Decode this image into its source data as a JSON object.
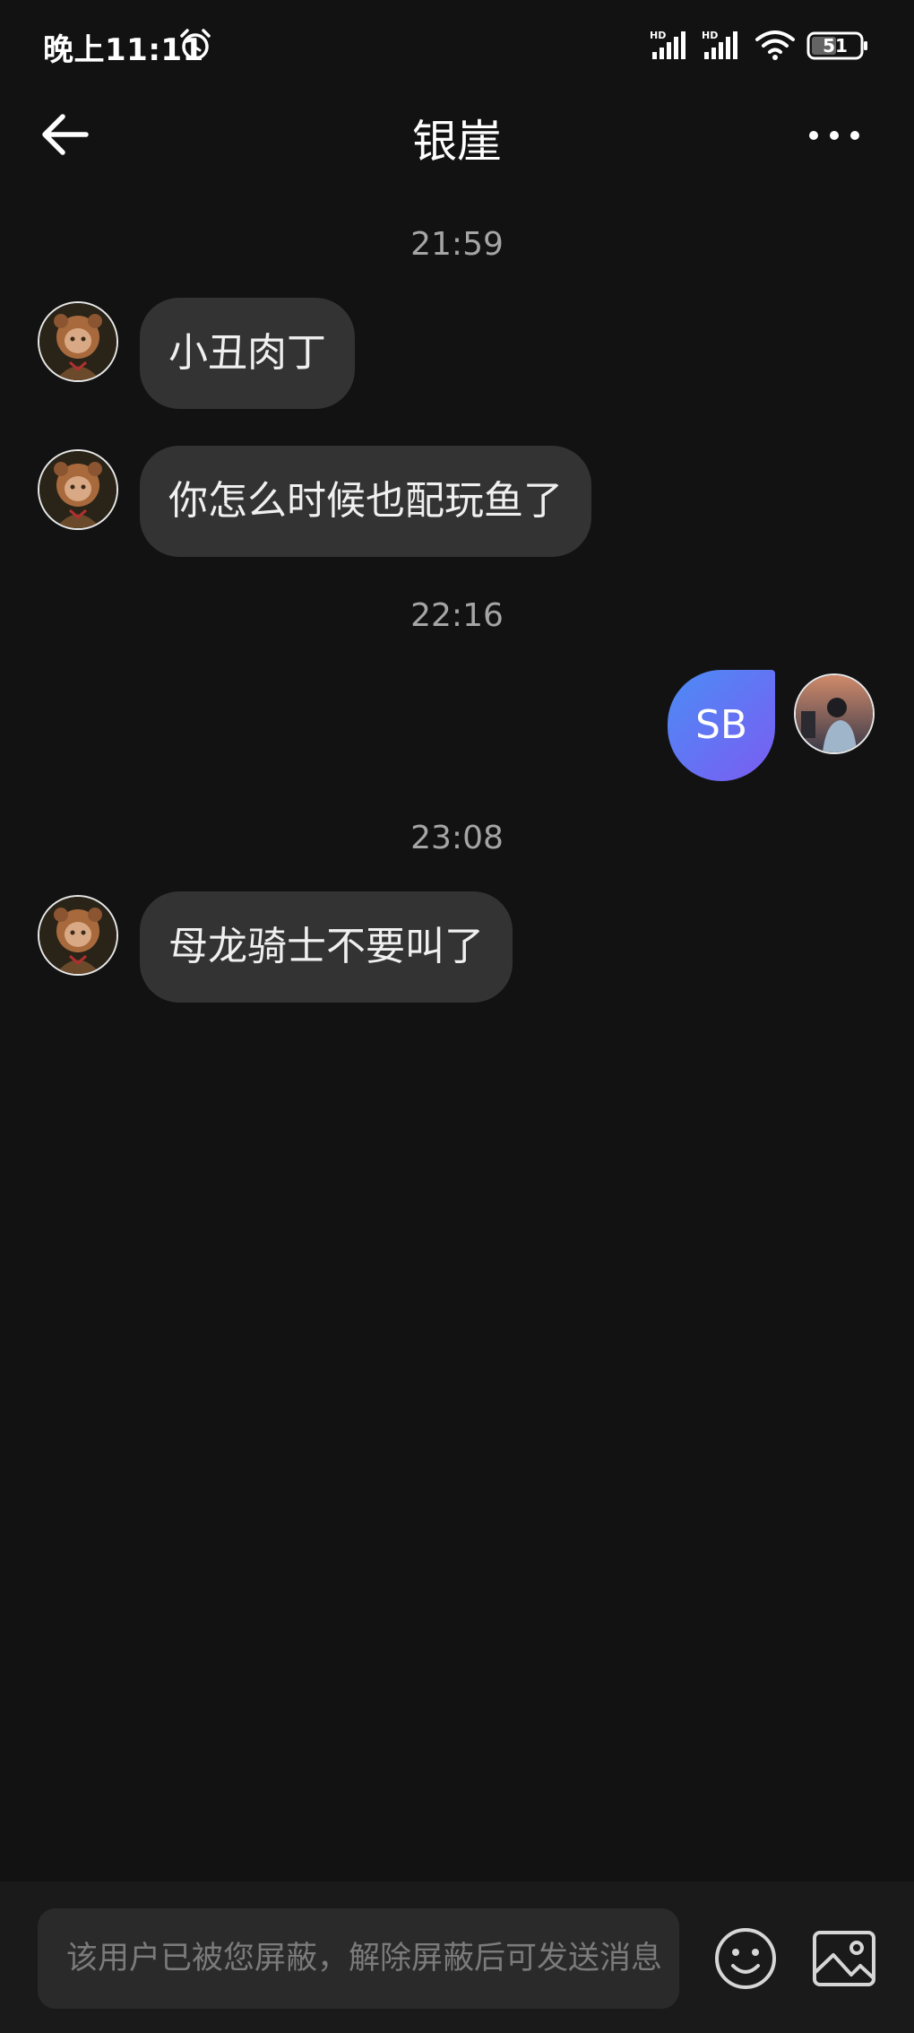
{
  "status_bar": {
    "time": "晚上11:11",
    "battery_level": "51",
    "icons": [
      "alarm-icon",
      "hd-signal-icon",
      "hd-signal-icon",
      "wifi-icon",
      "battery-icon"
    ]
  },
  "header": {
    "title": "银崖",
    "back_icon": "arrow-left-icon",
    "more_icon": "more-dots-icon"
  },
  "messages": [
    {
      "type": "timestamp",
      "text": "21:59"
    },
    {
      "type": "received",
      "text": "小丑肉丁"
    },
    {
      "type": "received",
      "text": "你怎么时候也配玩鱼了"
    },
    {
      "type": "timestamp",
      "text": "22:16"
    },
    {
      "type": "sent",
      "text": "SB"
    },
    {
      "type": "timestamp",
      "text": "23:08"
    },
    {
      "type": "received",
      "text": "母龙骑士不要叫了"
    }
  ],
  "input_bar": {
    "placeholder": "该用户已被您屏蔽，解除屏蔽后可发送消息",
    "emoji_icon": "emoji-icon",
    "image_icon": "image-icon"
  },
  "colors": {
    "background": "#121212",
    "bubble_received": "#333333",
    "bubble_sent_start": "#4b8cf5",
    "bubble_sent_end": "#7b5cf2",
    "timestamp_text": "#a5a5a5"
  }
}
